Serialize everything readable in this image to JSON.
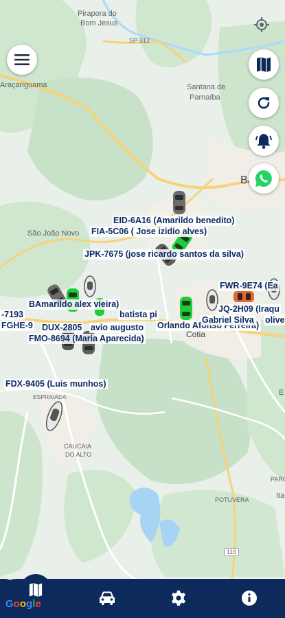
{
  "map": {
    "places": [
      {
        "text": "Pirapora do",
        "cls": ""
      },
      {
        "text": "Bom Jesus",
        "cls": ""
      },
      {
        "text": "SP-312",
        "cls": ""
      },
      {
        "text": "Araçariguama",
        "cls": ""
      },
      {
        "text": "Santana de",
        "cls": ""
      },
      {
        "text": "Parnaíba",
        "cls": ""
      },
      {
        "text": "Ba",
        "cls": "dark"
      },
      {
        "text": "São João Novo",
        "cls": ""
      },
      {
        "text": "Cotia",
        "cls": ""
      },
      {
        "text": "ESPRAIADA",
        "cls": ""
      },
      {
        "text": "CAUCAIA",
        "cls": ""
      },
      {
        "text": "DO ALTO",
        "cls": ""
      },
      {
        "text": "POTUVERA",
        "cls": ""
      },
      {
        "text": "116",
        "cls": ""
      },
      {
        "text": "PARQUE",
        "cls": ""
      },
      {
        "text": "Ita",
        "cls": ""
      },
      {
        "text": "E",
        "cls": ""
      }
    ]
  },
  "vehicles": [
    {
      "label": "EID-6A16 (Amarildo benedito)"
    },
    {
      "label": "FIA-5C06 ( Jose izidio alves)"
    },
    {
      "label": "JPK-7675 (jose ricardo santos da silva)"
    },
    {
      "label": "FWR-9E74 (Ea"
    },
    {
      "label": "BAmarildo alex vieira)"
    },
    {
      "label": "-7193"
    },
    {
      "label": "batista pi"
    },
    {
      "label": "JQ-2H09 (Iraqu"
    },
    {
      "label": "FGHE-9"
    },
    {
      "label": "DUX-2805"
    },
    {
      "label": "avio augusto"
    },
    {
      "label": "Orlando Afonso Ferreira)"
    },
    {
      "label": "Gabriel Silva"
    },
    {
      "label": "olivei"
    },
    {
      "label": "FMO-8694  (Maria Aparecida)"
    },
    {
      "label": "FDX-9405 (Luis munhos)"
    }
  ],
  "icons": {
    "menu": "menu-icon",
    "locate": "my-location-icon",
    "map": "map-icon",
    "refresh": "refresh-icon",
    "alarm": "bell-icon",
    "whatsapp": "whatsapp-icon",
    "nav_map": "map-icon",
    "nav_car": "car-icon",
    "nav_settings": "gear-icon",
    "nav_info": "info-icon"
  },
  "colors": {
    "nav_bar": "#0d2a5c",
    "label_text": "#0d2a66",
    "fab_icon": "#0d2a5c",
    "whatsapp": "#25d366",
    "car_green": "#1fcc3a",
    "car_gray": "#6b6b6b"
  },
  "attribution": {
    "text": "Google"
  }
}
